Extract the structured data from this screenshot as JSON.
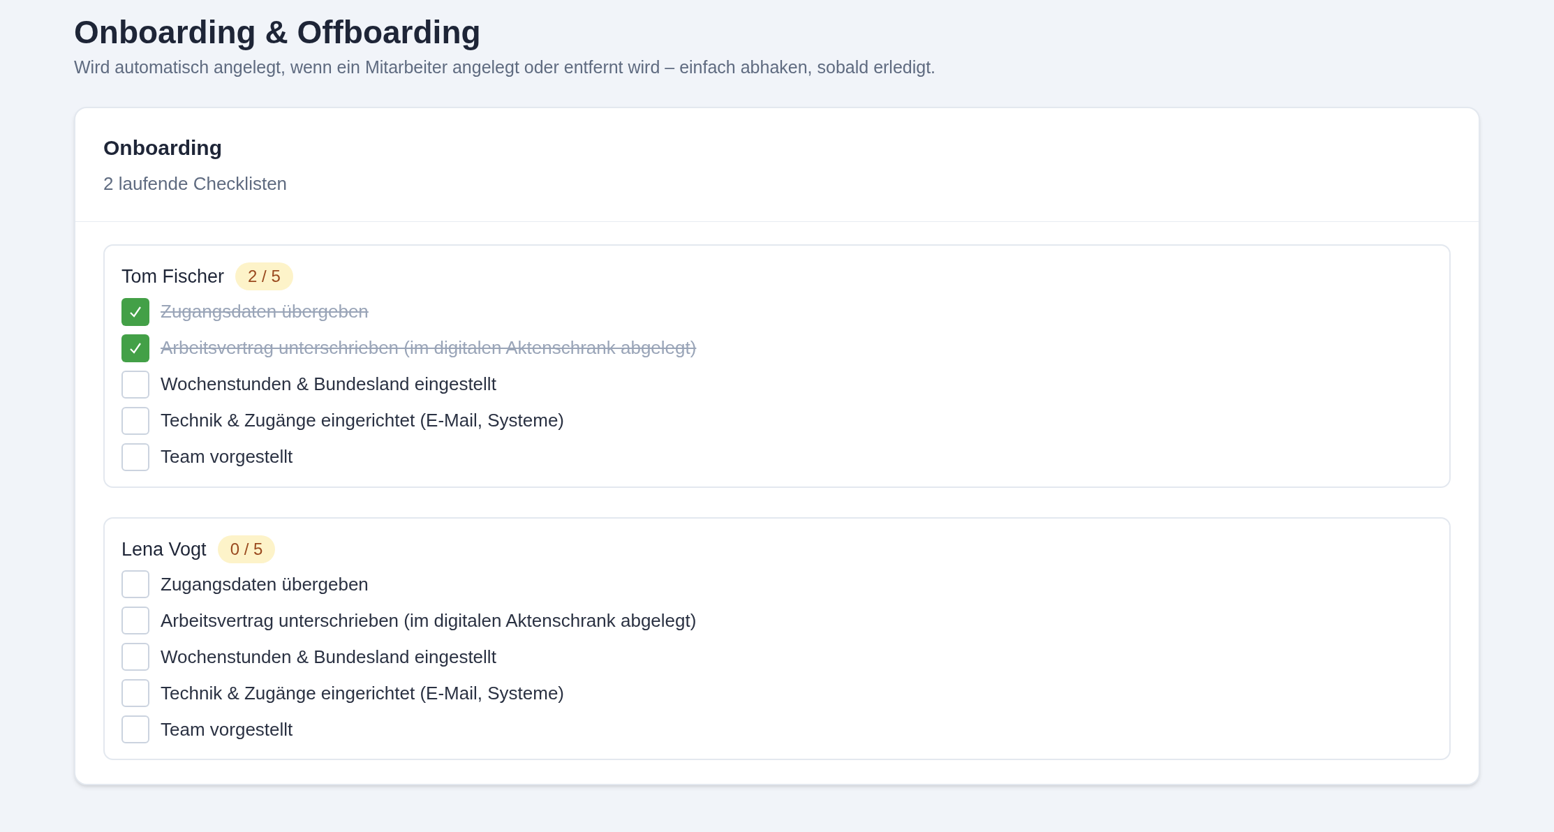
{
  "page": {
    "title": "Onboarding & Offboarding",
    "subtitle": "Wird automatisch angelegt, wenn ein Mitarbeiter angelegt oder entfernt wird – einfach abhaken, sobald erledigt."
  },
  "section": {
    "title": "Onboarding",
    "subtitle": "2 laufende Checklisten"
  },
  "checklists": [
    {
      "name": "Tom Fischer",
      "progress": "2 / 5",
      "tasks": [
        {
          "label": "Zugangsdaten übergeben",
          "checked": true
        },
        {
          "label": "Arbeitsvertrag unterschrieben (im digitalen Aktenschrank abgelegt)",
          "checked": true
        },
        {
          "label": "Wochenstunden & Bundesland eingestellt",
          "checked": false
        },
        {
          "label": "Technik & Zugänge eingerichtet (E-Mail, Systeme)",
          "checked": false
        },
        {
          "label": "Team vorgestellt",
          "checked": false
        }
      ]
    },
    {
      "name": "Lena Vogt",
      "progress": "0 / 5",
      "tasks": [
        {
          "label": "Zugangsdaten übergeben",
          "checked": false
        },
        {
          "label": "Arbeitsvertrag unterschrieben (im digitalen Aktenschrank abgelegt)",
          "checked": false
        },
        {
          "label": "Wochenstunden & Bundesland eingestellt",
          "checked": false
        },
        {
          "label": "Technik & Zugänge eingerichtet (E-Mail, Systeme)",
          "checked": false
        },
        {
          "label": "Team vorgestellt",
          "checked": false
        }
      ]
    }
  ]
}
